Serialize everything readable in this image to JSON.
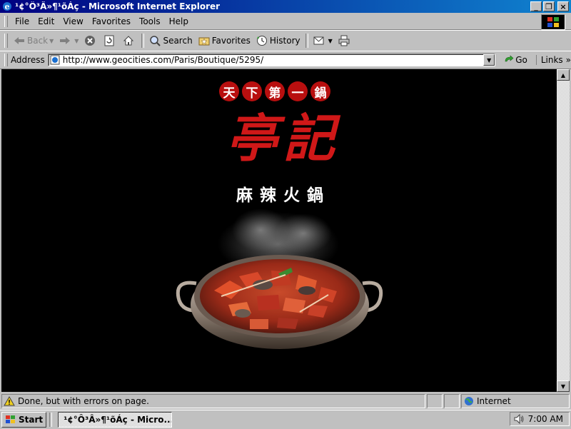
{
  "window": {
    "title": "¹¢°Ô³Â»¶¹õÁç - Microsoft Internet Explorer",
    "minimize_symbol": "_",
    "restore_symbol": "❐",
    "close_symbol": "×"
  },
  "menu": {
    "items": [
      "File",
      "Edit",
      "View",
      "Favorites",
      "Tools",
      "Help"
    ]
  },
  "toolbar": {
    "back": "Back",
    "search": "Search",
    "favorites": "Favorites",
    "history": "History"
  },
  "address": {
    "label": "Address",
    "url": "http://www.geocities.com/Paris/Boutique/5295/",
    "go": "Go",
    "links": "Links",
    "links_more": "»"
  },
  "page": {
    "slogan_chars": [
      "天",
      "下",
      "第",
      "一",
      "鍋"
    ],
    "brand": "亭記",
    "subtitle": "麻辣火鍋",
    "accent_color": "#b80f0f",
    "background_color": "#000000"
  },
  "status": {
    "text": "Done, but with errors on page.",
    "zone": "Internet"
  },
  "taskbar": {
    "start": "Start",
    "task_title": "¹¢°Ô³Â»¶¹õÁç - Micro...",
    "clock": "7:00 AM"
  }
}
